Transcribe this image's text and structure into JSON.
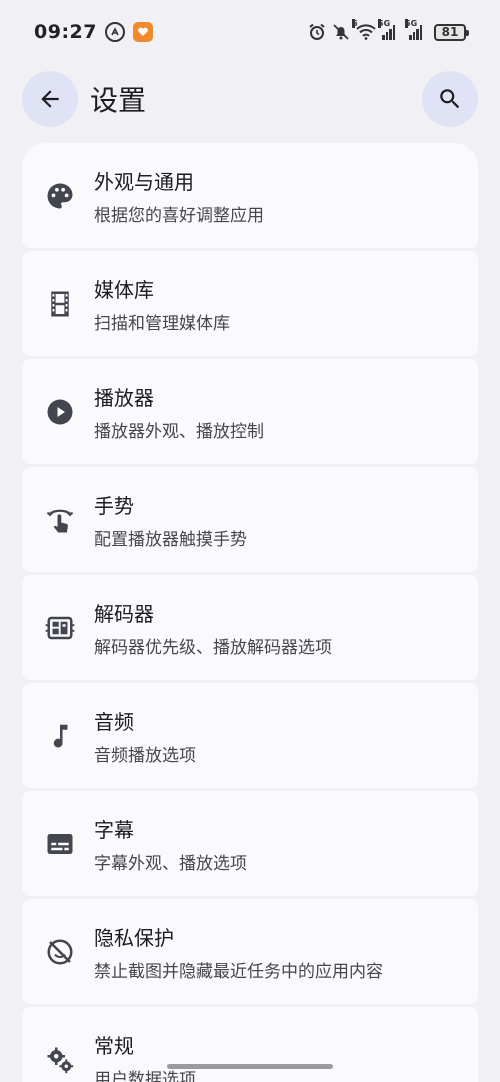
{
  "status": {
    "time": "09:27",
    "battery": "81",
    "net1": "5G",
    "net2": "5G",
    "wifi_tag": "6"
  },
  "header": {
    "title": "设置"
  },
  "items": [
    {
      "title": "外观与通用",
      "subtitle": "根据您的喜好调整应用",
      "icon": "palette-icon"
    },
    {
      "title": "媒体库",
      "subtitle": "扫描和管理媒体库",
      "icon": "film-icon"
    },
    {
      "title": "播放器",
      "subtitle": "播放器外观、播放控制",
      "icon": "play-circle-icon"
    },
    {
      "title": "手势",
      "subtitle": "配置播放器触摸手势",
      "icon": "gesture-icon"
    },
    {
      "title": "解码器",
      "subtitle": "解码器优先级、播放解码器选项",
      "icon": "decoder-icon"
    },
    {
      "title": "音频",
      "subtitle": "音频播放选项",
      "icon": "music-note-icon"
    },
    {
      "title": "字幕",
      "subtitle": "字幕外观、播放选项",
      "icon": "subtitles-icon"
    },
    {
      "title": "隐私保护",
      "subtitle": "禁止截图并隐藏最近任务中的应用内容",
      "icon": "privacy-icon"
    },
    {
      "title": "常规",
      "subtitle": "用户数据选项",
      "icon": "gears-icon"
    }
  ],
  "colors": {
    "background": "#f1f1f5",
    "card": "#fafafd",
    "button": "#dfe3f5",
    "icon": "#44464f"
  }
}
